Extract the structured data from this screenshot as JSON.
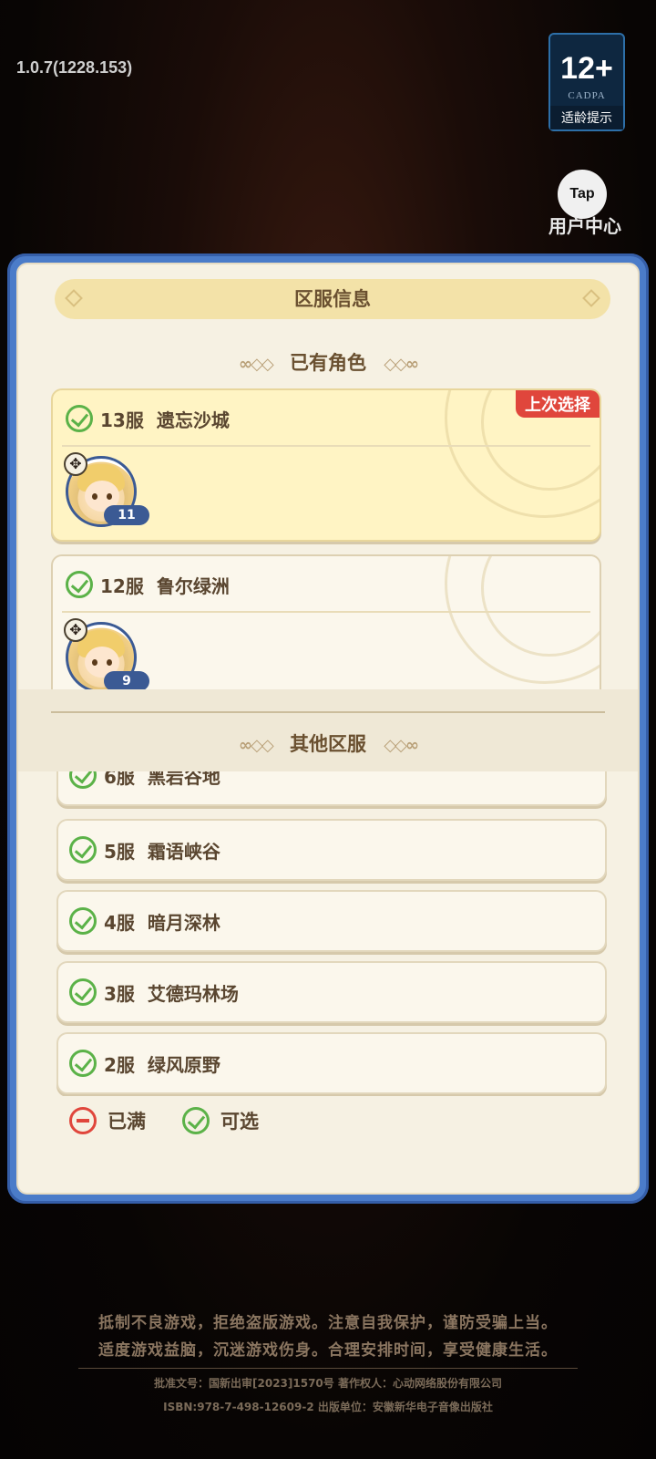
{
  "header": {
    "version": "1.0.7(1228.153)",
    "age_rating": "12+",
    "age_org": "CADPA",
    "age_tip": "适龄提示",
    "tap_label": "Tap",
    "user_center": "用户中心"
  },
  "dialog": {
    "title": "区服信息",
    "owned_section": "已有角色",
    "other_section": "其他区服",
    "last_selected_tag": "上次选择",
    "owned": [
      {
        "server": "13服",
        "name": "遗忘沙城",
        "level": "11",
        "selected": true
      },
      {
        "server": "12服",
        "name": "鲁尔绿洲",
        "level": "9",
        "selected": false
      }
    ],
    "others": [
      {
        "server": "6服",
        "name": "黑岩谷地"
      },
      {
        "server": "5服",
        "name": "霜语峡谷"
      },
      {
        "server": "4服",
        "name": "暗月深林"
      },
      {
        "server": "3服",
        "name": "艾德玛林场"
      },
      {
        "server": "2服",
        "name": "绿风原野"
      }
    ],
    "legend": {
      "full": "已满",
      "available": "可选"
    }
  },
  "footer": {
    "line1": "抵制不良游戏，拒绝盗版游戏。注意自我保护，谨防受骗上当。",
    "line2": "适度游戏益脑，沉迷游戏伤身。合理安排时间，享受健康生活。",
    "line3": "批准文号：国新出审[2023]1570号   著作权人：心动网络股份有限公司",
    "line4": "ISBN:978-7-498-12609-2      出版单位：安徽新华电子音像出版社"
  },
  "colors": {
    "dialog_frame": "#4b7cc9",
    "panel": "#f6f1e3",
    "selected_card": "#fff4c4",
    "tag_red": "#e0463c",
    "check_green": "#5bb248"
  }
}
